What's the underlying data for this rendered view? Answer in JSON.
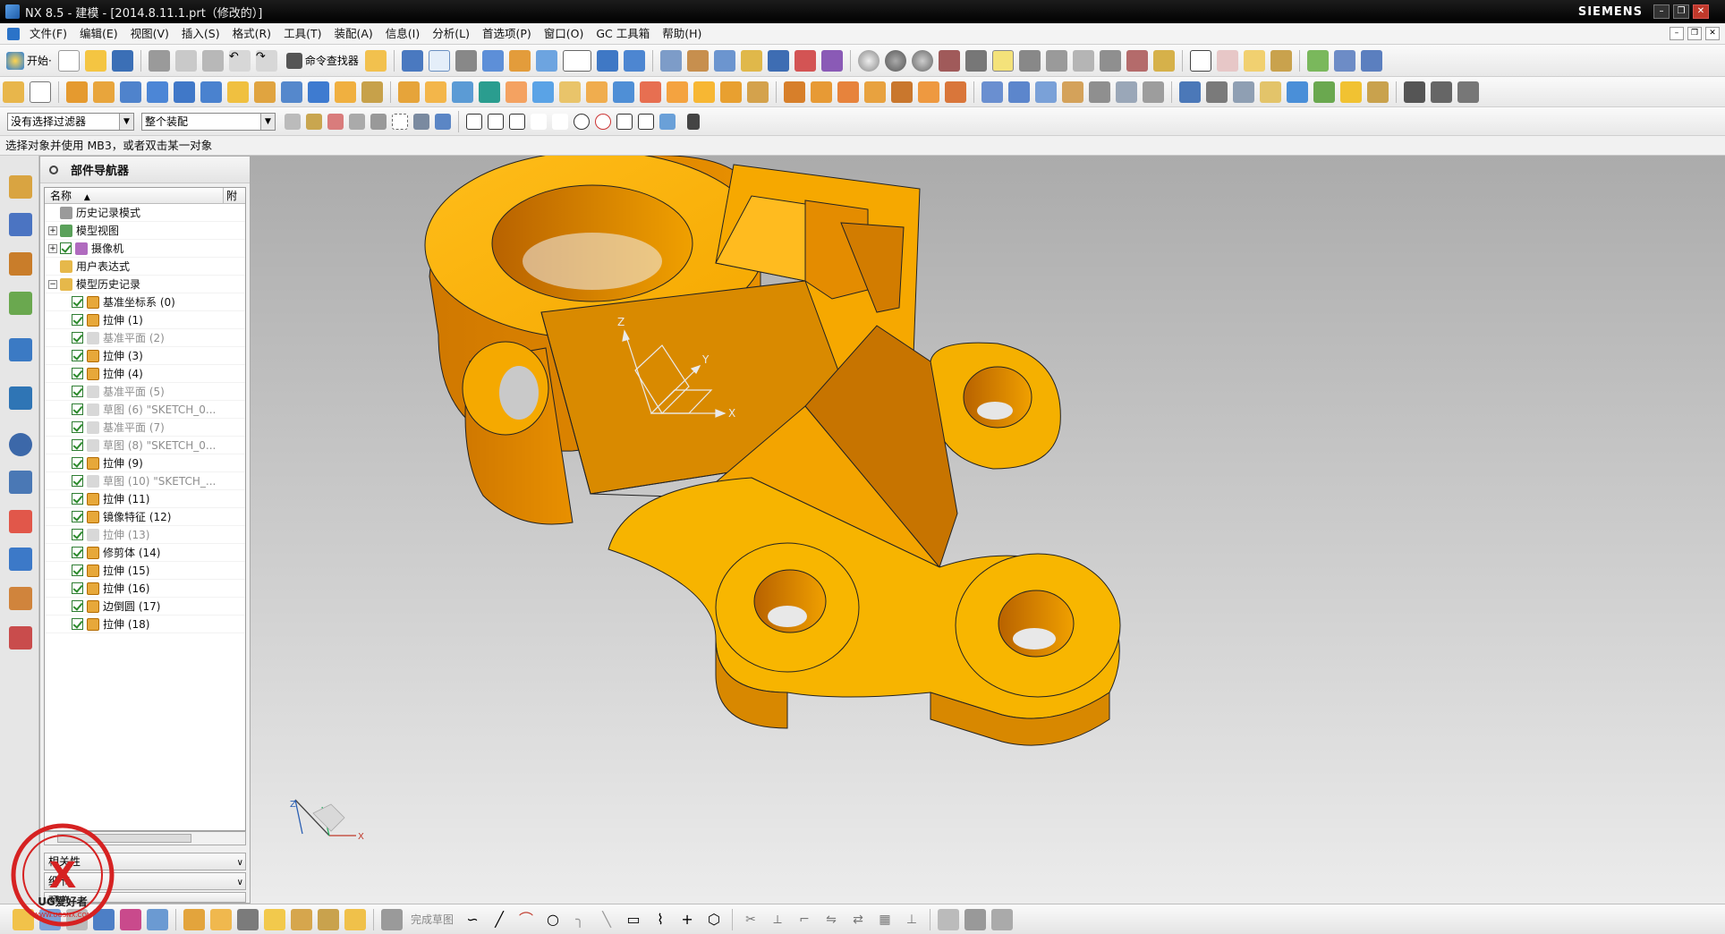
{
  "window": {
    "title": "NX 8.5 - 建模 - [2014.8.11.1.prt（修改的）]",
    "brand": "SIEMENS",
    "controls": [
      "–",
      "❐",
      "✕"
    ]
  },
  "menubar": {
    "items": [
      "文件(F)",
      "编辑(E)",
      "视图(V)",
      "插入(S)",
      "格式(R)",
      "工具(T)",
      "装配(A)",
      "信息(I)",
      "分析(L)",
      "首选项(P)",
      "窗口(O)",
      "GC 工具箱",
      "帮助(H)"
    ]
  },
  "toolbar": {
    "start_label": "开始·",
    "command_finder": "命令查找器"
  },
  "selection_bar": {
    "filter_value": "没有选择过滤器",
    "scope_value": "整个装配"
  },
  "cue_line": "选择对象并使用 MB3，或者双击某一对象",
  "navigator": {
    "title": "部件导航器",
    "col_name": "名称",
    "col_sort": "▲",
    "col_attached": "附",
    "nodes": [
      {
        "label": "历史记录模式",
        "level": 1,
        "expand": "",
        "check": false,
        "dim": false
      },
      {
        "label": "模型视图",
        "level": 1,
        "expand": "+",
        "check": false,
        "dim": false
      },
      {
        "label": "摄像机",
        "level": 1,
        "expand": "+",
        "check": true,
        "dim": false
      },
      {
        "label": "用户表达式",
        "level": 1,
        "expand": "",
        "check": false,
        "dim": false
      },
      {
        "label": "模型历史记录",
        "level": 1,
        "expand": "−",
        "check": false,
        "dim": false
      },
      {
        "label": "基准坐标系 (0)",
        "level": 2,
        "check": true,
        "dim": false
      },
      {
        "label": "拉伸 (1)",
        "level": 2,
        "check": true,
        "dim": false
      },
      {
        "label": "基准平面 (2)",
        "level": 2,
        "check": true,
        "dim": true
      },
      {
        "label": "拉伸 (3)",
        "level": 2,
        "check": true,
        "dim": false
      },
      {
        "label": "拉伸 (4)",
        "level": 2,
        "check": true,
        "dim": false
      },
      {
        "label": "基准平面 (5)",
        "level": 2,
        "check": true,
        "dim": true
      },
      {
        "label": "草图 (6) \"SKETCH_0...",
        "level": 2,
        "check": true,
        "dim": true
      },
      {
        "label": "基准平面 (7)",
        "level": 2,
        "check": true,
        "dim": true
      },
      {
        "label": "草图 (8) \"SKETCH_0...",
        "level": 2,
        "check": true,
        "dim": true
      },
      {
        "label": "拉伸 (9)",
        "level": 2,
        "check": true,
        "dim": false
      },
      {
        "label": "草图 (10) \"SKETCH_...",
        "level": 2,
        "check": true,
        "dim": true
      },
      {
        "label": "拉伸 (11)",
        "level": 2,
        "check": true,
        "dim": false
      },
      {
        "label": "镜像特征 (12)",
        "level": 2,
        "check": true,
        "dim": false
      },
      {
        "label": "拉伸 (13)",
        "level": 2,
        "check": true,
        "dim": true
      },
      {
        "label": "修剪体 (14)",
        "level": 2,
        "check": true,
        "dim": false
      },
      {
        "label": "拉伸 (15)",
        "level": 2,
        "check": true,
        "dim": false
      },
      {
        "label": "拉伸 (16)",
        "level": 2,
        "check": true,
        "dim": false
      },
      {
        "label": "边倒圆 (17)",
        "level": 2,
        "check": true,
        "dim": false
      },
      {
        "label": "拉伸 (18)",
        "level": 2,
        "check": true,
        "dim": false
      }
    ],
    "panels": [
      "相关性",
      "细节",
      "预览"
    ]
  },
  "viewport": {
    "part_color": "#f5b000",
    "triad_labels": {
      "x": "X",
      "y": "Y",
      "z": "Z"
    }
  },
  "bottombar": {
    "finish_sketch": "完成草图"
  },
  "watermark": {
    "text": "UG爱好者",
    "url": "WWW.UGSNX.COM"
  }
}
